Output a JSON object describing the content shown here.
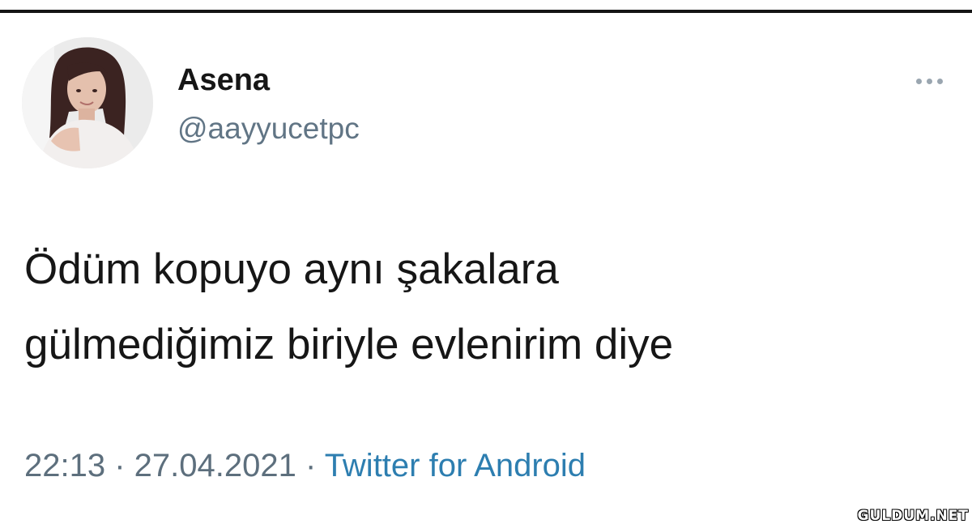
{
  "tweet": {
    "author": {
      "display_name": "Asena",
      "handle": "@aayyucetpc",
      "avatar_icon": "profile-photo"
    },
    "more_icon": "more-horizontal-icon",
    "text": "Ödüm kopuyo aynı şakalara\ngülmediğimiz biriyle evlenirim diye",
    "time": "22:13",
    "separator": " · ",
    "date": "27.04.2021",
    "source": "Twitter for Android"
  },
  "watermark": "GULDUM.NET",
  "colors": {
    "text": "#161616",
    "muted": "#5d6f7d",
    "link": "#2d7eb0",
    "rule": "#151515"
  }
}
